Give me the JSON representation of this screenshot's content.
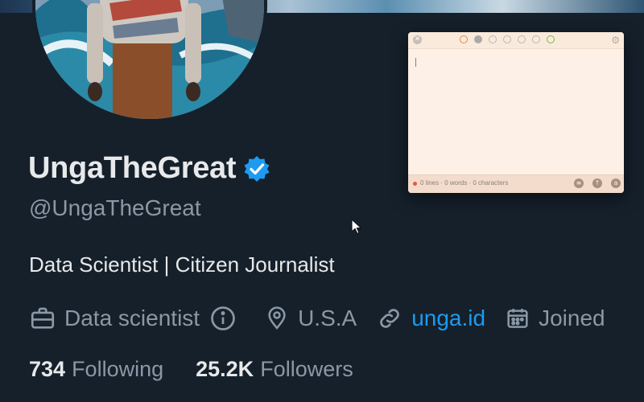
{
  "profile": {
    "display_name": "UngaTheGreat",
    "handle": "@UngaTheGreat",
    "bio": "Data Scientist | Citizen Journalist",
    "occupation": "Data scientist",
    "location": "U.S.A",
    "website": "unga.id",
    "joined": "Joined"
  },
  "counts": {
    "following_num": "734",
    "following_label": "Following",
    "followers_num": "25.2K",
    "followers_label": "Followers"
  },
  "notes_panel": {
    "stats": "0 lines · 0 words · 0 characters"
  },
  "colors": {
    "background": "#15202b",
    "link": "#1d9bf0",
    "verified": "#1d9bf0",
    "muted_text": "#8b98a5",
    "notes_bg": "#fdf0e6"
  },
  "icons": {
    "verified": "verified-badge-icon",
    "occupation": "briefcase-icon",
    "info": "info-icon",
    "location": "location-pin-icon",
    "website": "link-icon",
    "joined": "calendar-icon",
    "cursor": "mouse-pointer-icon"
  }
}
